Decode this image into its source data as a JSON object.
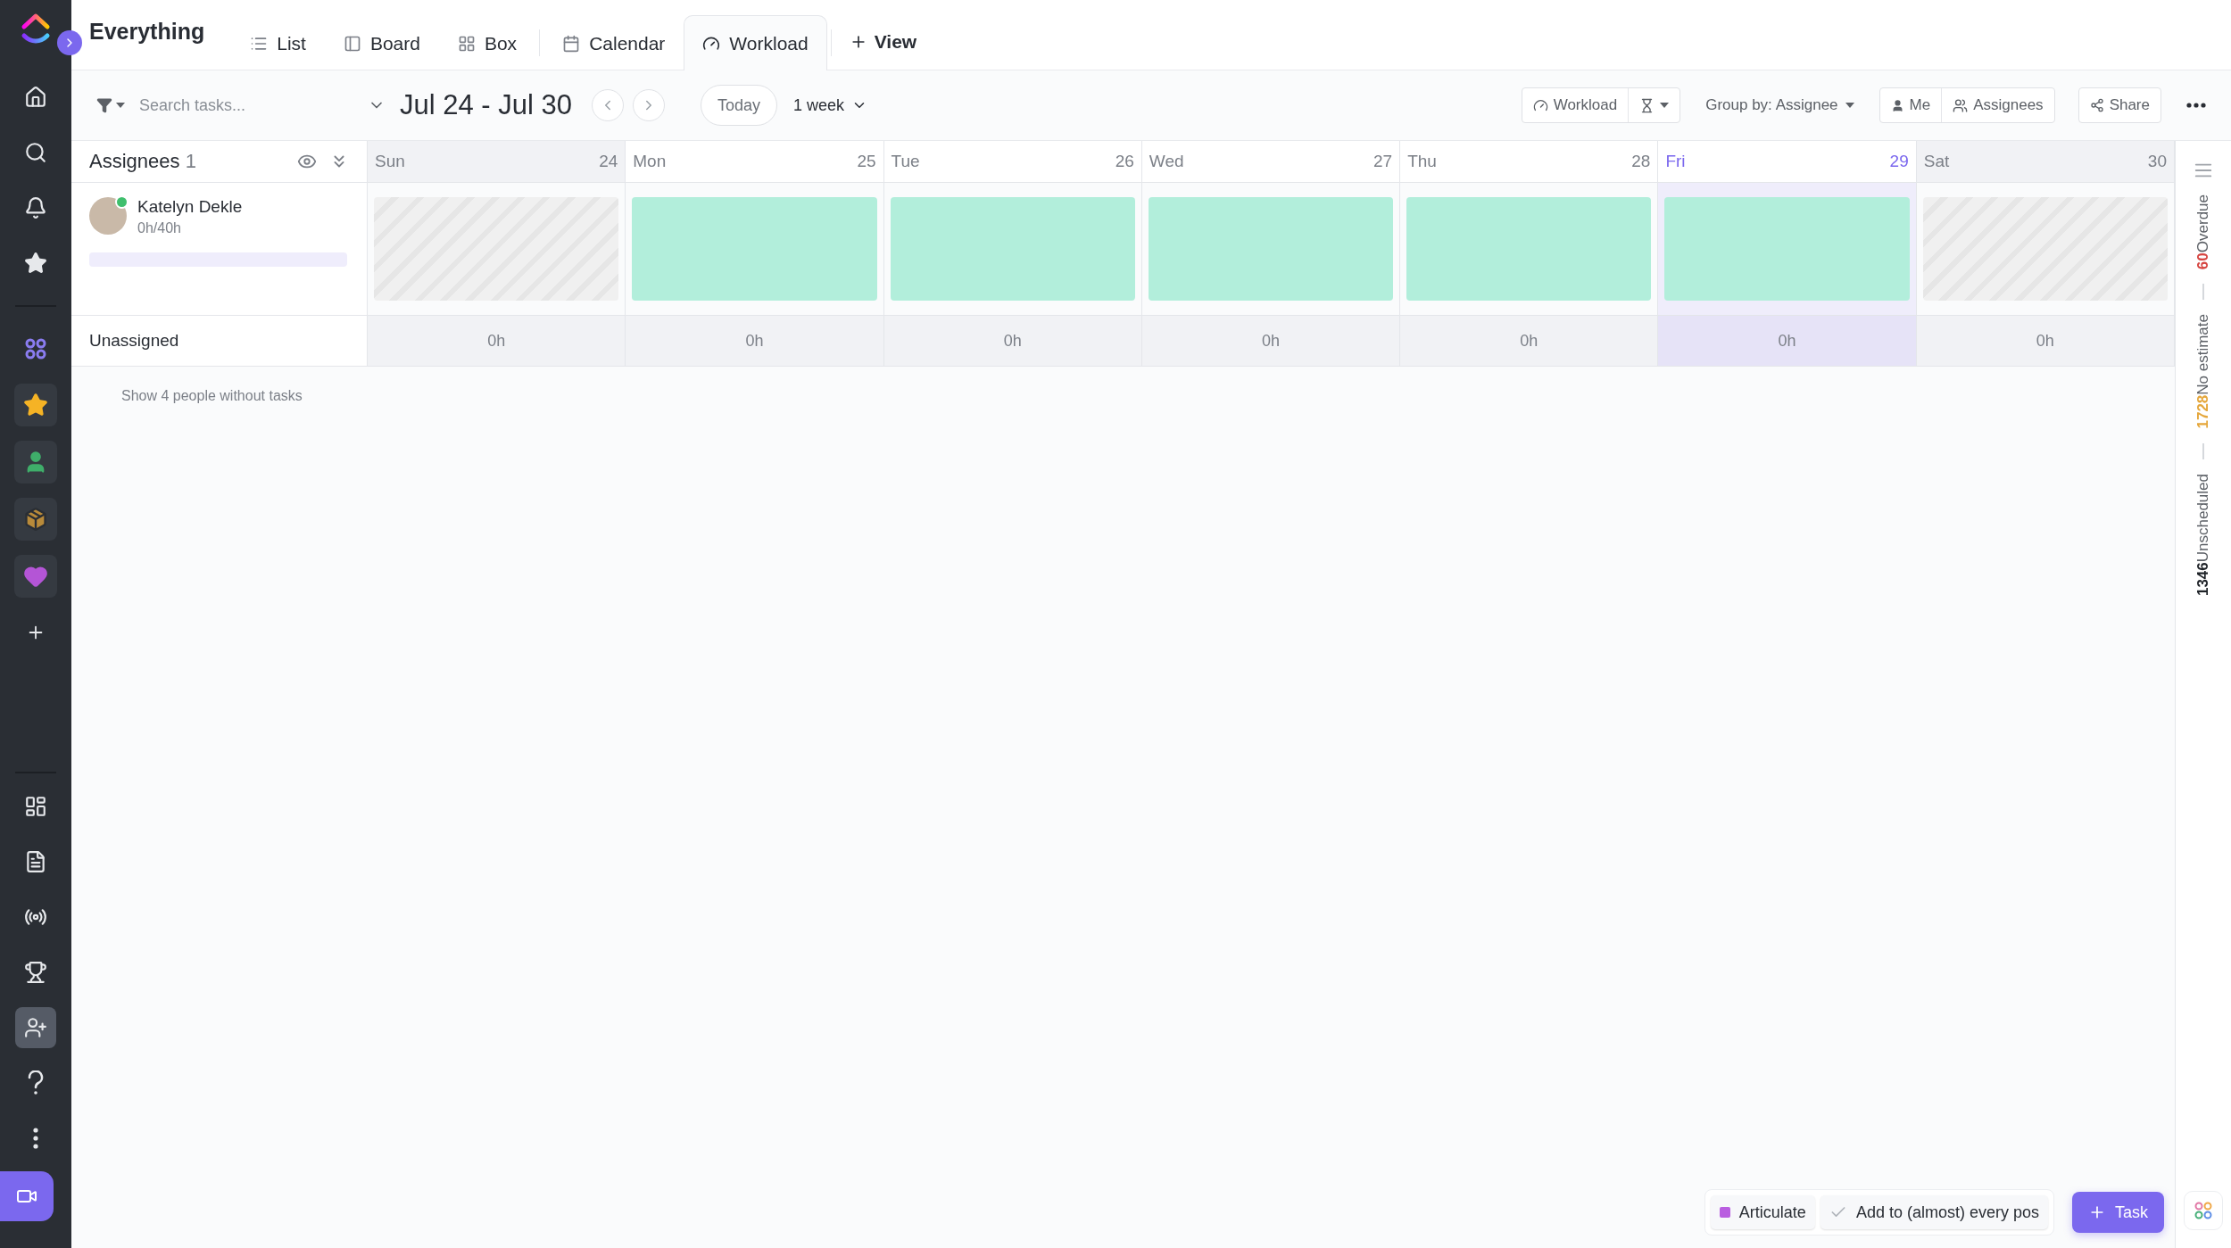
{
  "app": {
    "title": "Everything"
  },
  "sidebar": {
    "top": [
      {
        "kind": "home",
        "selected": false
      },
      {
        "kind": "search",
        "selected": false
      },
      {
        "kind": "bell",
        "selected": false
      },
      {
        "kind": "star",
        "selected": false
      }
    ],
    "spaces": [
      {
        "kind": "spaces",
        "selected": false
      },
      {
        "kind": "favorite",
        "selected": false
      },
      {
        "kind": "person",
        "selected": false
      },
      {
        "kind": "box",
        "selected": false
      },
      {
        "kind": "heart",
        "selected": false
      },
      {
        "kind": "add",
        "selected": false
      }
    ],
    "bottom": [
      {
        "kind": "dashboards",
        "selected": false
      },
      {
        "kind": "docs",
        "selected": false
      },
      {
        "kind": "pulse",
        "selected": false
      },
      {
        "kind": "goals",
        "selected": false
      },
      {
        "kind": "invite",
        "selected": true
      },
      {
        "kind": "help",
        "selected": false
      },
      {
        "kind": "more",
        "selected": false
      }
    ]
  },
  "tabs": [
    {
      "label": "List",
      "kind": "list",
      "selected": false
    },
    {
      "label": "Board",
      "kind": "board",
      "selected": false
    },
    {
      "label": "Box",
      "kind": "box",
      "selected": false
    },
    {
      "label": "Calendar",
      "kind": "calendar",
      "selected": false
    },
    {
      "label": "Workload",
      "kind": "workload",
      "selected": true
    }
  ],
  "add_view": "View",
  "toolbar": {
    "search": {
      "placeholder": "Search tasks..."
    },
    "date_range": "Jul 24 - Jul 30",
    "today": "Today",
    "period": "1 week",
    "workload": "Workload",
    "group_by_label": "Group by:",
    "group_by_value": "Assignee",
    "me": "Me",
    "assignees": "Assignees",
    "share": "Share"
  },
  "grid": {
    "header": {
      "label": "Assignees",
      "count": "1"
    },
    "days": [
      {
        "day": "Sun",
        "date": "24",
        "kind": "off",
        "selected": false,
        "unassigned": "0h"
      },
      {
        "day": "Mon",
        "date": "25",
        "kind": "work",
        "selected": false,
        "unassigned": "0h"
      },
      {
        "day": "Tue",
        "date": "26",
        "kind": "work",
        "selected": false,
        "unassigned": "0h"
      },
      {
        "day": "Wed",
        "date": "27",
        "kind": "work",
        "selected": false,
        "unassigned": "0h"
      },
      {
        "day": "Thu",
        "date": "28",
        "kind": "work",
        "selected": false,
        "unassigned": "0h"
      },
      {
        "day": "Fri",
        "date": "29",
        "kind": "work",
        "selected": true,
        "unassigned": "0h"
      },
      {
        "day": "Sat",
        "date": "30",
        "kind": "off",
        "selected": false,
        "unassigned": "0h"
      }
    ],
    "people": [
      {
        "name": "Katelyn Dekle",
        "hours": "0h/40h",
        "online": true
      }
    ],
    "unassigned_label": "Unassigned",
    "show_more": "Show 4 people without tasks"
  },
  "summary": [
    {
      "count": "60",
      "label": "Overdue",
      "color": "#d64541"
    },
    {
      "count": "1728",
      "label": "No estimate",
      "color": "#e5a73b"
    },
    {
      "count": "1346",
      "label": "Unscheduled",
      "color": "#1f2328"
    }
  ],
  "tray": {
    "chips": [
      {
        "kind": "tag",
        "label": "Articulate",
        "color": "#b95ee0"
      },
      {
        "kind": "done",
        "label": "Add to (almost) every pos"
      }
    ],
    "task_button": "Task"
  }
}
